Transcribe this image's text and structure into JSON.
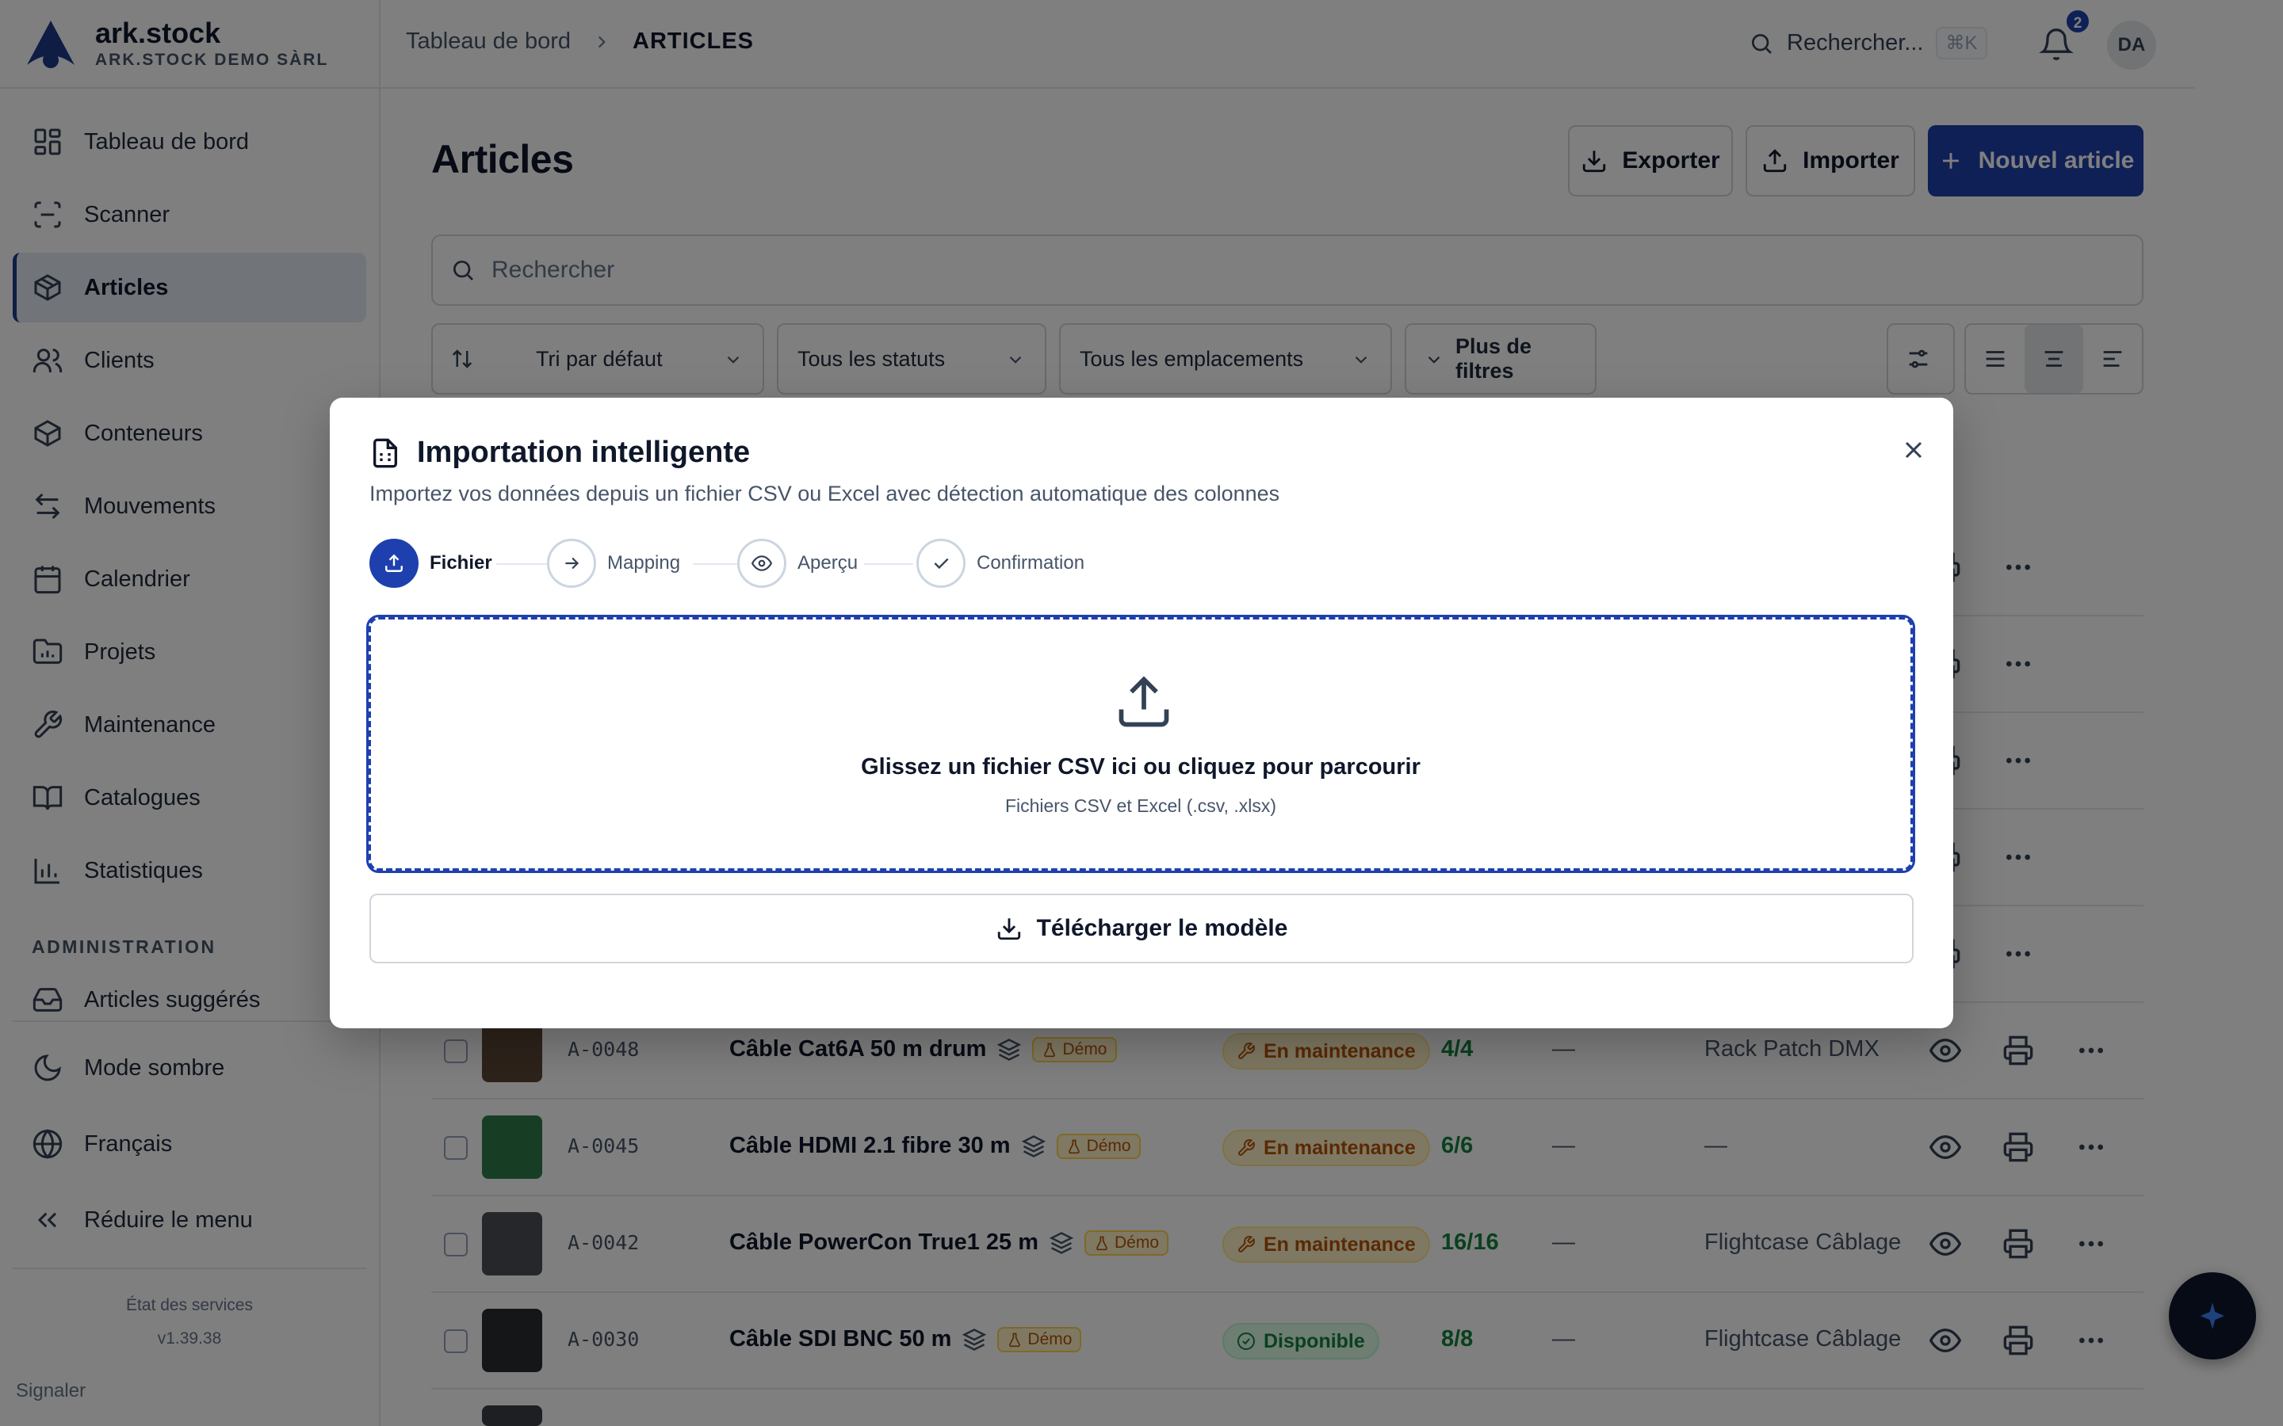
{
  "brand": {
    "name": "ark.stock",
    "org": "ARK.STOCK DEMO SÀRL"
  },
  "sidebar": {
    "items": [
      {
        "label": "Tableau de bord",
        "icon": "dashboard-icon"
      },
      {
        "label": "Scanner",
        "icon": "scan-icon"
      },
      {
        "label": "Articles",
        "icon": "box-icon",
        "active": true
      },
      {
        "label": "Clients",
        "icon": "users-icon"
      },
      {
        "label": "Conteneurs",
        "icon": "container-icon"
      },
      {
        "label": "Mouvements",
        "icon": "arrows-icon"
      },
      {
        "label": "Calendrier",
        "icon": "calendar-icon"
      },
      {
        "label": "Projets",
        "icon": "folder-chart-icon"
      },
      {
        "label": "Maintenance",
        "icon": "wrench-icon"
      },
      {
        "label": "Catalogues",
        "icon": "book-icon"
      },
      {
        "label": "Statistiques",
        "icon": "bar-chart-icon"
      }
    ],
    "admin_heading": "ADMINISTRATION",
    "admin_items": [
      {
        "label": "Articles suggérés",
        "icon": "inbox-icon"
      }
    ],
    "bottom_items": [
      {
        "label": "Mode sombre",
        "icon": "moon-icon"
      },
      {
        "label": "Français",
        "icon": "globe-icon"
      },
      {
        "label": "Réduire le menu",
        "icon": "chevrons-left-icon"
      }
    ],
    "service_status": "État des services",
    "version": "v1.39.38",
    "report": "Signaler"
  },
  "header": {
    "breadcrumb_parent": "Tableau de bord",
    "breadcrumb_current": "ARTICLES",
    "search_label": "Rechercher...",
    "search_shortcut": "⌘K",
    "notification_count": "2",
    "avatar_initials": "DA"
  },
  "main": {
    "title": "Articles",
    "export_label": "Exporter",
    "import_label": "Importer",
    "new_label": "Nouvel article",
    "search_placeholder": "Rechercher",
    "filters": {
      "sort": "Tri par défaut",
      "status": "Tous les statuts",
      "locations": "Tous les emplacements",
      "more": "Plus de filtres"
    },
    "rows": [
      {
        "ref": "A-0048",
        "name": "Câble Cat6A 50 m drum",
        "badge": "Démo",
        "status": "En maintenance",
        "status_type": "maint",
        "qty": "4/4",
        "dash": "—",
        "location": "Rack Patch DMX",
        "thumb_color": "#5b4636"
      },
      {
        "ref": "A-0045",
        "name": "Câble HDMI 2.1 fibre 30 m",
        "badge": "Démo",
        "status": "En maintenance",
        "status_type": "maint",
        "qty": "6/6",
        "dash": "—",
        "location": "—",
        "thumb_color": "#2f7d4a"
      },
      {
        "ref": "A-0042",
        "name": "Câble PowerCon True1 25 m",
        "badge": "Démo",
        "status": "En maintenance",
        "status_type": "maint",
        "qty": "16/16",
        "dash": "—",
        "location": "Flightcase Câblage",
        "thumb_color": "#4b4f55"
      },
      {
        "ref": "A-0030",
        "name": "Câble SDI BNC 50 m",
        "badge": "Démo",
        "status": "Disponible",
        "status_type": "dispo",
        "qty": "8/8",
        "dash": "—",
        "location": "Flightcase Câblage",
        "thumb_color": "#2a2d31"
      }
    ]
  },
  "dialog": {
    "title": "Importation intelligente",
    "description": "Importez vos données depuis un fichier CSV ou Excel avec détection automatique des colonnes",
    "steps": [
      {
        "label": "Fichier",
        "icon": "upload-icon",
        "current": true
      },
      {
        "label": "Mapping",
        "icon": "arrow-right-icon"
      },
      {
        "label": "Aperçu",
        "icon": "eye-icon"
      },
      {
        "label": "Confirmation",
        "icon": "check-icon"
      }
    ],
    "drop_main": "Glissez un fichier CSV ici ou cliquez pour parcourir",
    "drop_sub": "Fichiers CSV et Excel (.csv, .xlsx)",
    "download_template": "Télécharger le modèle"
  },
  "colors": {
    "primary": "#1e40af",
    "maintenance": "#b45309",
    "available": "#15803d"
  }
}
